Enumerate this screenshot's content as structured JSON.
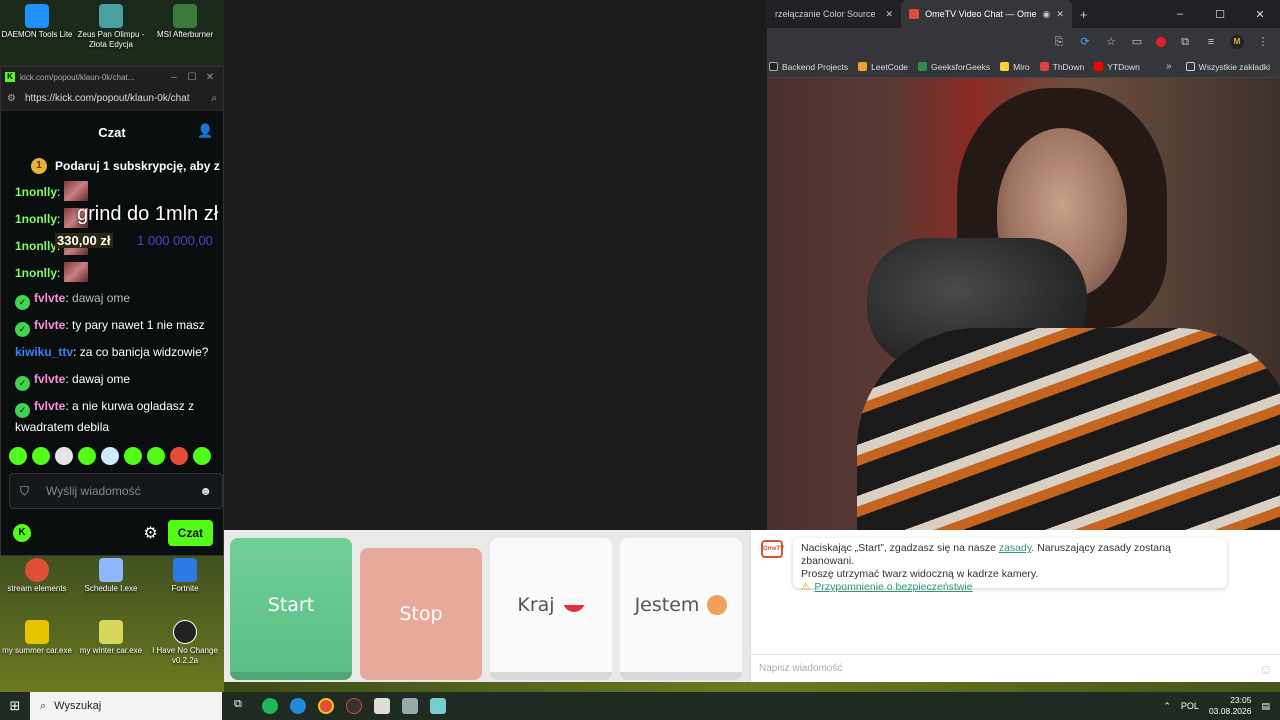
{
  "desktop": {
    "icons": [
      {
        "label": "DAEMON Tools Lite",
        "icon": "daemon-tools-icon",
        "color": "#1e90ff"
      },
      {
        "label": "Zeus Pan Olimpu - Złota Edycja",
        "icon": "zeus-icon",
        "color": "#4aa0a0"
      },
      {
        "label": "MSI Afterburner",
        "icon": "msi-afterburner-icon",
        "color": "#3b7a3b"
      },
      {
        "label": "stream elements",
        "icon": "chrome-icon",
        "color": "#e04e3a"
      },
      {
        "label": "Schedule I.exe",
        "icon": "schedule-icon",
        "color": "#8fb7ff"
      },
      {
        "label": "Fortnite",
        "icon": "fortnite-icon",
        "color": "#2c7be5"
      },
      {
        "label": "my summer car.exe",
        "icon": "summer-car-icon",
        "color": "#e6c400"
      },
      {
        "label": "my winter car.exe",
        "icon": "winter-car-icon",
        "color": "#d6d65a"
      },
      {
        "label": "I Have No Change v0.2.2a",
        "icon": "unreal-icon",
        "color": "#222222"
      }
    ]
  },
  "kick": {
    "window_title": "kick.com/popout/klaun-0k/chat...",
    "url": "https://kick.com/popout/klaun-0k/chat",
    "chat_title": "Czat",
    "pinned": "Podaruj 1 subskrypcję, aby z",
    "pinned_badge": "1",
    "overlay_grind": "grind do 1mln zł",
    "overlay_money": "330,00 zł",
    "overlay_goal": "1 000 000,00",
    "messages": [
      {
        "user": "1nonlly",
        "text": "",
        "color": "#7dff5a"
      },
      {
        "user": "1nonlly",
        "text": "",
        "color": "#7dff5a"
      },
      {
        "user": "1nonlly",
        "text": "",
        "color": "#7dff5a"
      },
      {
        "user": "1nonlly",
        "text": "",
        "color": "#7dff5a"
      },
      {
        "user": "fvlvte",
        "text": "dawaj ome",
        "color": "#ff8de0"
      },
      {
        "user": "fvlvte",
        "text": "ty pary nawet 1 nie masz",
        "color": "#ff8de0"
      },
      {
        "user": "kiwiku_ttv",
        "text": "za co banicja widzowie?",
        "color": "#3b82f6"
      },
      {
        "user": "fvlvte",
        "text": "dawaj ome",
        "color": "#ff8de0"
      },
      {
        "user": "fvlvte",
        "text": "a nie kurwa ogladasz z kwadratem debila",
        "color": "#ff8de0"
      }
    ],
    "send_placeholder": "Wyślij wiadomość",
    "send_button": "Czat"
  },
  "browser": {
    "tabs": [
      {
        "label": "rzełączanie Color Source",
        "active": false
      },
      {
        "label": "OmeTV Video Chat — Ome",
        "active": true
      }
    ],
    "bookmarks": [
      {
        "label": "Backend Projects",
        "color": "#222222"
      },
      {
        "label": "LeetCode",
        "color": "#f0a030"
      },
      {
        "label": "GeeksforGeeks",
        "color": "#2f8d46"
      },
      {
        "label": "Miro",
        "color": "#ffd02f"
      },
      {
        "label": "ThDown",
        "color": "#e04040"
      },
      {
        "label": "YTDown",
        "color": "#ff0000"
      }
    ],
    "bookmarks_folder": "Wszystkie zakładki"
  },
  "ometv": {
    "start": "Start",
    "stop": "Stop",
    "country": "Kraj",
    "gender": "Jestem",
    "logo": "OmeTV",
    "notice_part1": "Naciskając „Start”, zgadzasz się na nasze ",
    "notice_link": "zasady",
    "notice_part2": ". Naruszający zasady zostaną zbanowani.",
    "notice_line2": "Proszę utrzymać twarz widoczną w kadrze kamery.",
    "safety_link": "Przypomnienie o bezpieczeństwie",
    "message_placeholder": "Napisz wiadomość"
  },
  "taskbar": {
    "search": "Wyszukaj",
    "lang": "POL",
    "time": "23:05",
    "date": "03.08.2026"
  }
}
